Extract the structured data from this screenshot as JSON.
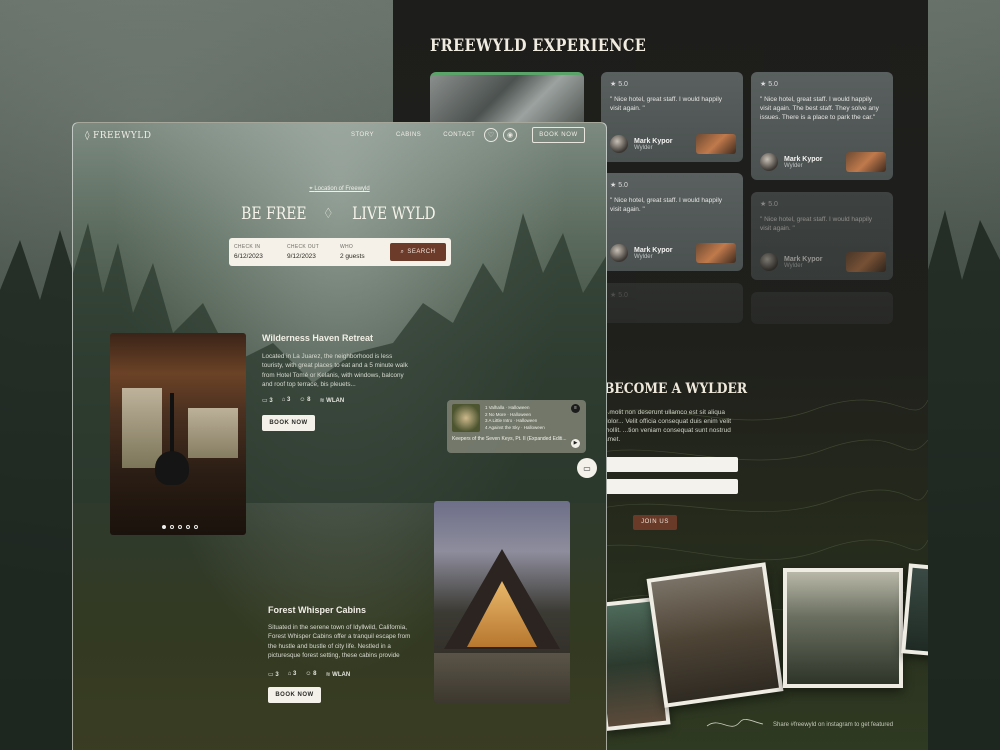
{
  "experience": {
    "title": "FREEWYLD EXPERIENCE",
    "reviews": [
      {
        "stars": "★ 5.0",
        "quote": "\" Nice hotel, great staff. I would happily visit again. \"",
        "name": "Mark Kypor",
        "role": "Wylder"
      },
      {
        "stars": "★ 5.0",
        "quote": "\" Nice hotel, great staff. I would happily visit again. The best staff. They solve any issues. There is a place to park the car.\"",
        "name": "Mark Kypor",
        "role": "Wylder"
      },
      {
        "stars": "★ 5.0",
        "quote": "\" Nice hotel, great staff. I would happily visit again. \"",
        "name": "Mark Kypor",
        "role": "Wylder"
      },
      {
        "stars": "★ 5.0",
        "quote": "\" Nice hotel, great staff. I would happily visit again. \"",
        "name": "Mark Kypor",
        "role": "Wylder"
      }
    ],
    "extra_stars": "★ 5.0"
  },
  "wylder": {
    "title": "BECOME A WYLDER",
    "text": "...molit non deserunt ullamco est sit aliqua dolor... Velit officia consequat duis enim velit mollit. ...tion veniam consequat sunt nostrud amet.",
    "join_label": "JOIN US",
    "ig_caption": "Share #freewyld on instagram to get featured"
  },
  "nav": {
    "logo": "FREEWYLD",
    "links": [
      "STORY",
      "CABINS",
      "CONTACT"
    ],
    "book_label": "BOOK NOW"
  },
  "hero": {
    "location": "Location of Freewyld",
    "left": "BE FREE",
    "right": "LIVE WYLD",
    "search": {
      "checkin_label": "CHECK IN",
      "checkin_value": "6/12/2023",
      "checkout_label": "CHECK OUT",
      "checkout_value": "9/12/2023",
      "who_label": "WHO",
      "who_value": "2 guests",
      "button": "SEARCH"
    }
  },
  "cabins": [
    {
      "title": "Wilderness Haven Retreat",
      "desc": "Located in La Juarez, the neighborhood is less touristy, with great places to eat and a 5 minute walk from Hotel Tomé or Kelanis, with windows, balcony and roof top terrace, bis pleuets...",
      "beds": "3",
      "baths": "3",
      "guests": "8",
      "wifi": "WLAN",
      "book": "BOOK NOW"
    },
    {
      "title": "Forest Whisper Cabins",
      "desc": "Situated in the serene town of Idyllwild, California, Forest Whisper Cabins offer a tranquil escape from the hustle and bustle of city life. Nestled in a picturesque forest setting, these cabins provide",
      "beds": "3",
      "baths": "3",
      "guests": "8",
      "wifi": "WLAN",
      "book": "BOOK NOW"
    }
  ],
  "music": {
    "tracks": [
      "1  Valhalla · Halloween",
      "2  No More · Halloween",
      "3  A Little Intro · Halloween",
      "4  Against the Sky · Halloween"
    ],
    "song": "Keepers of the Seven Keys, Pt. II (Expanded Editi..."
  }
}
